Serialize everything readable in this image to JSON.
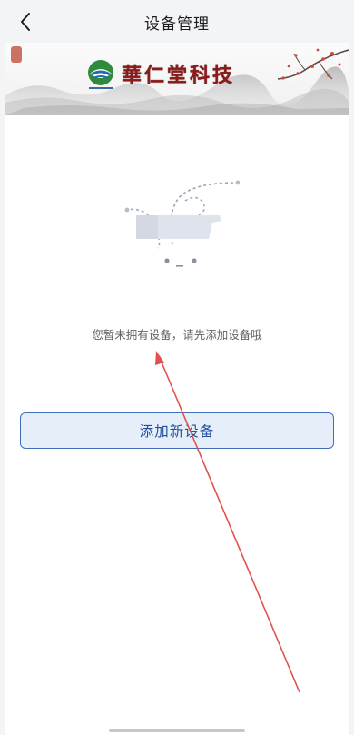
{
  "header": {
    "title": "设备管理",
    "back_icon": "chevron-left-icon"
  },
  "banner": {
    "brand_name": "華仁堂科技"
  },
  "empty_state": {
    "message": "您暂未拥有设备，请先添加设备哦",
    "illustration_icon": "empty-box-icon"
  },
  "actions": {
    "add_device_label": "添加新设备"
  },
  "colors": {
    "accent": "#1f4f9e",
    "button_bg": "#e6eef9",
    "annotation": "#e0524f",
    "brand_text": "#8a1b1b"
  }
}
